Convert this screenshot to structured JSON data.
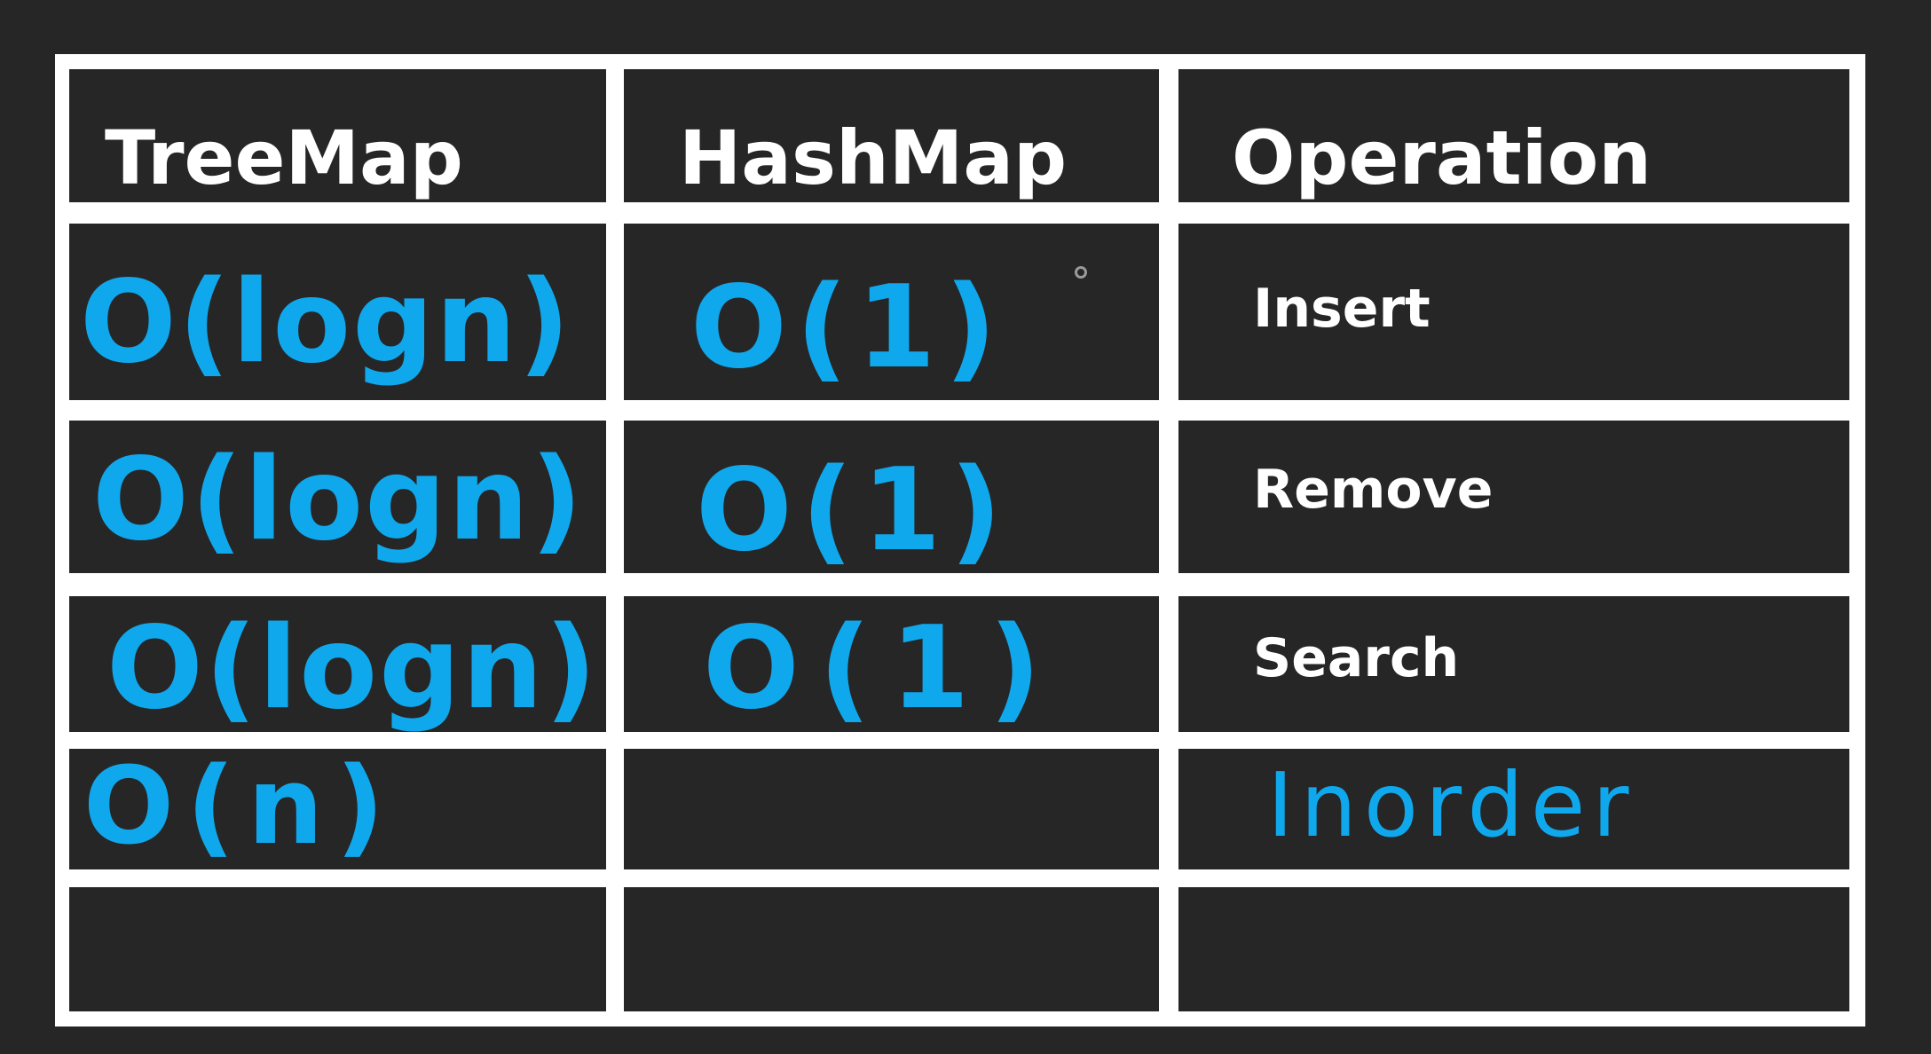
{
  "table": {
    "headers": {
      "treemap": "TreeMap",
      "hashmap": "HashMap",
      "operation": "Operation"
    },
    "rows": [
      {
        "treemap": "O(logn)",
        "hashmap": "O(1)",
        "operation": "Insert"
      },
      {
        "treemap": "O(logn)",
        "hashmap": "O(1)",
        "operation": "Remove"
      },
      {
        "treemap": "O(logn)",
        "hashmap": "O(1)",
        "operation": "Search"
      },
      {
        "treemap": "O(n)",
        "hashmap": "",
        "operation": "Inorder"
      },
      {
        "treemap": "",
        "hashmap": "",
        "operation": ""
      }
    ]
  },
  "colors": {
    "background": "#262626",
    "grid_lines": "#ffffff",
    "handwriting": "#10a8ec",
    "text": "#ffffff"
  }
}
